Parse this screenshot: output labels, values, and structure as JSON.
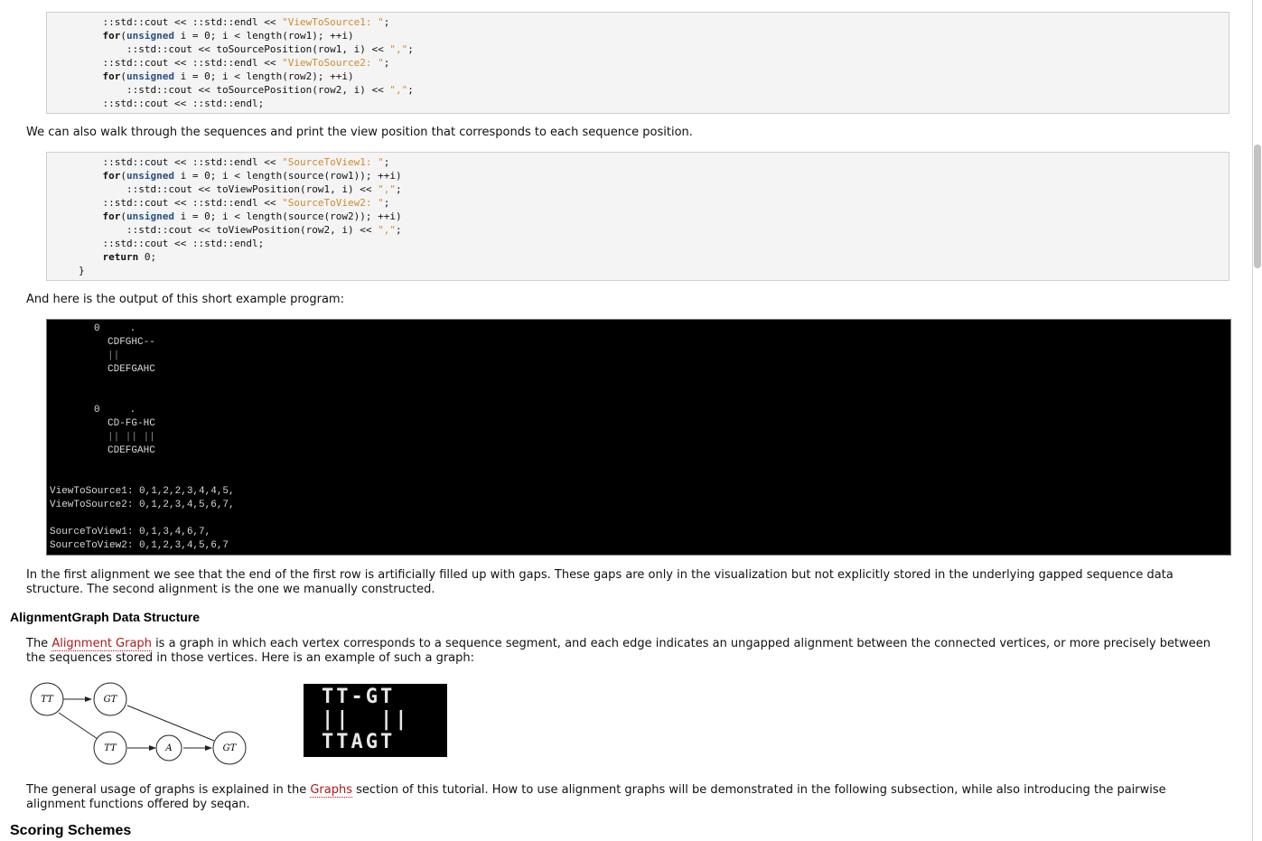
{
  "code_block_1": {
    "lines": [
      [
        {
          "t": "    ::std::cout << ::std::endl << ",
          "c": ""
        },
        {
          "t": "\"ViewToSource1: \"",
          "c": "str"
        },
        {
          "t": ";",
          "c": ""
        }
      ],
      [
        {
          "t": "    ",
          "c": ""
        },
        {
          "t": "for",
          "c": "kw"
        },
        {
          "t": "(",
          "c": ""
        },
        {
          "t": "unsigned",
          "c": "ty"
        },
        {
          "t": " i = 0; i < length(row1); ++i)",
          "c": ""
        }
      ],
      [
        {
          "t": "        ::std::cout << toSourcePosition(row1, i) << ",
          "c": ""
        },
        {
          "t": "\",\"",
          "c": "str"
        },
        {
          "t": ";",
          "c": ""
        }
      ],
      [
        {
          "t": "    ::std::cout << ::std::endl << ",
          "c": ""
        },
        {
          "t": "\"ViewToSource2: \"",
          "c": "str"
        },
        {
          "t": ";",
          "c": ""
        }
      ],
      [
        {
          "t": "    ",
          "c": ""
        },
        {
          "t": "for",
          "c": "kw"
        },
        {
          "t": "(",
          "c": ""
        },
        {
          "t": "unsigned",
          "c": "ty"
        },
        {
          "t": " i = 0; i < length(row2); ++i)",
          "c": ""
        }
      ],
      [
        {
          "t": "        ::std::cout << toSourcePosition(row2, i) << ",
          "c": ""
        },
        {
          "t": "\",\"",
          "c": "str"
        },
        {
          "t": ";",
          "c": ""
        }
      ],
      [
        {
          "t": "    ::std::cout << ::std::endl;",
          "c": ""
        }
      ]
    ]
  },
  "paragraph_1": "We can also walk through the sequences and print the view position that corresponds to each sequence position.",
  "code_block_2": {
    "lines": [
      [
        {
          "t": "    ::std::cout << ::std::endl << ",
          "c": ""
        },
        {
          "t": "\"SourceToView1: \"",
          "c": "str"
        },
        {
          "t": ";",
          "c": ""
        }
      ],
      [
        {
          "t": "    ",
          "c": ""
        },
        {
          "t": "for",
          "c": "kw"
        },
        {
          "t": "(",
          "c": ""
        },
        {
          "t": "unsigned",
          "c": "ty"
        },
        {
          "t": " i = 0; i < length(source(row1)); ++i)",
          "c": ""
        }
      ],
      [
        {
          "t": "        ::std::cout << toViewPosition(row1, i) << ",
          "c": ""
        },
        {
          "t": "\",\"",
          "c": "str"
        },
        {
          "t": ";",
          "c": ""
        }
      ],
      [
        {
          "t": "    ::std::cout << ::std::endl << ",
          "c": ""
        },
        {
          "t": "\"SourceToView2: \"",
          "c": "str"
        },
        {
          "t": ";",
          "c": ""
        }
      ],
      [
        {
          "t": "    ",
          "c": ""
        },
        {
          "t": "for",
          "c": "kw"
        },
        {
          "t": "(",
          "c": ""
        },
        {
          "t": "unsigned",
          "c": "ty"
        },
        {
          "t": " i = 0; i < length(source(row2)); ++i)",
          "c": ""
        }
      ],
      [
        {
          "t": "        ::std::cout << toViewPosition(row2, i) << ",
          "c": ""
        },
        {
          "t": "\",\"",
          "c": "str"
        },
        {
          "t": ";",
          "c": ""
        }
      ],
      [
        {
          "t": "    ::std::cout << ::std::endl;",
          "c": ""
        }
      ],
      [
        {
          "t": "    ",
          "c": ""
        },
        {
          "t": "return",
          "c": "kw"
        },
        {
          "t": " 0;",
          "c": ""
        }
      ],
      [
        {
          "t": "}",
          "c": ""
        }
      ]
    ]
  },
  "paragraph_2": "And here is the output of this short example program:",
  "console_output": {
    "alignment_1": [
      "0     .",
      "CDFGHC--",
      "||",
      "CDEFGAHC"
    ],
    "alignment_2": [
      "0     .",
      "CD-FG-HC",
      "|| || ||",
      "CDEFGAHC"
    ],
    "view_to_source": [
      "ViewToSource1: 0,1,2,2,3,4,4,5,",
      "ViewToSource2: 0,1,2,3,4,5,6,7,"
    ],
    "source_to_view": [
      "SourceToView1: 0,1,3,4,6,7,",
      "SourceToView2: 0,1,2,3,4,5,6,7"
    ]
  },
  "paragraph_3": "In the first alignment we see that the end of the first row is artificially filled up with gaps. These gaps are only in the visualization but not explicitly stored in the underlying gapped sequence data structure. The second alignment is the one we manually constructed.",
  "heading_alignment_graph": "AlignmentGraph Data Structure",
  "paragraph_4": {
    "before": "The ",
    "link": "Alignment Graph",
    "after": " is a graph in which each vertex corresponds to a sequence segment, and each edge indicates an ungapped alignment between the connected vertices, or more precisely between the sequences stored in those vertices. Here is an example of such a graph:"
  },
  "graph_nodes": {
    "n1": "TT",
    "n2": "GT",
    "n3": "TT",
    "n4": "A",
    "n5": "GT"
  },
  "alignment_image": {
    "row_top": "TT-GT",
    "row_mid": "||  ||",
    "row_bottom": "TTAGT"
  },
  "paragraph_5": {
    "before": "The general usage of graphs is explained in the ",
    "link": "Graphs",
    "after": " section of this tutorial. How to use alignment graphs will be demonstrated in the following subsection, while also introducing the pairwise alignment functions offered by seqan."
  },
  "heading_scoring": "Scoring Schemes"
}
